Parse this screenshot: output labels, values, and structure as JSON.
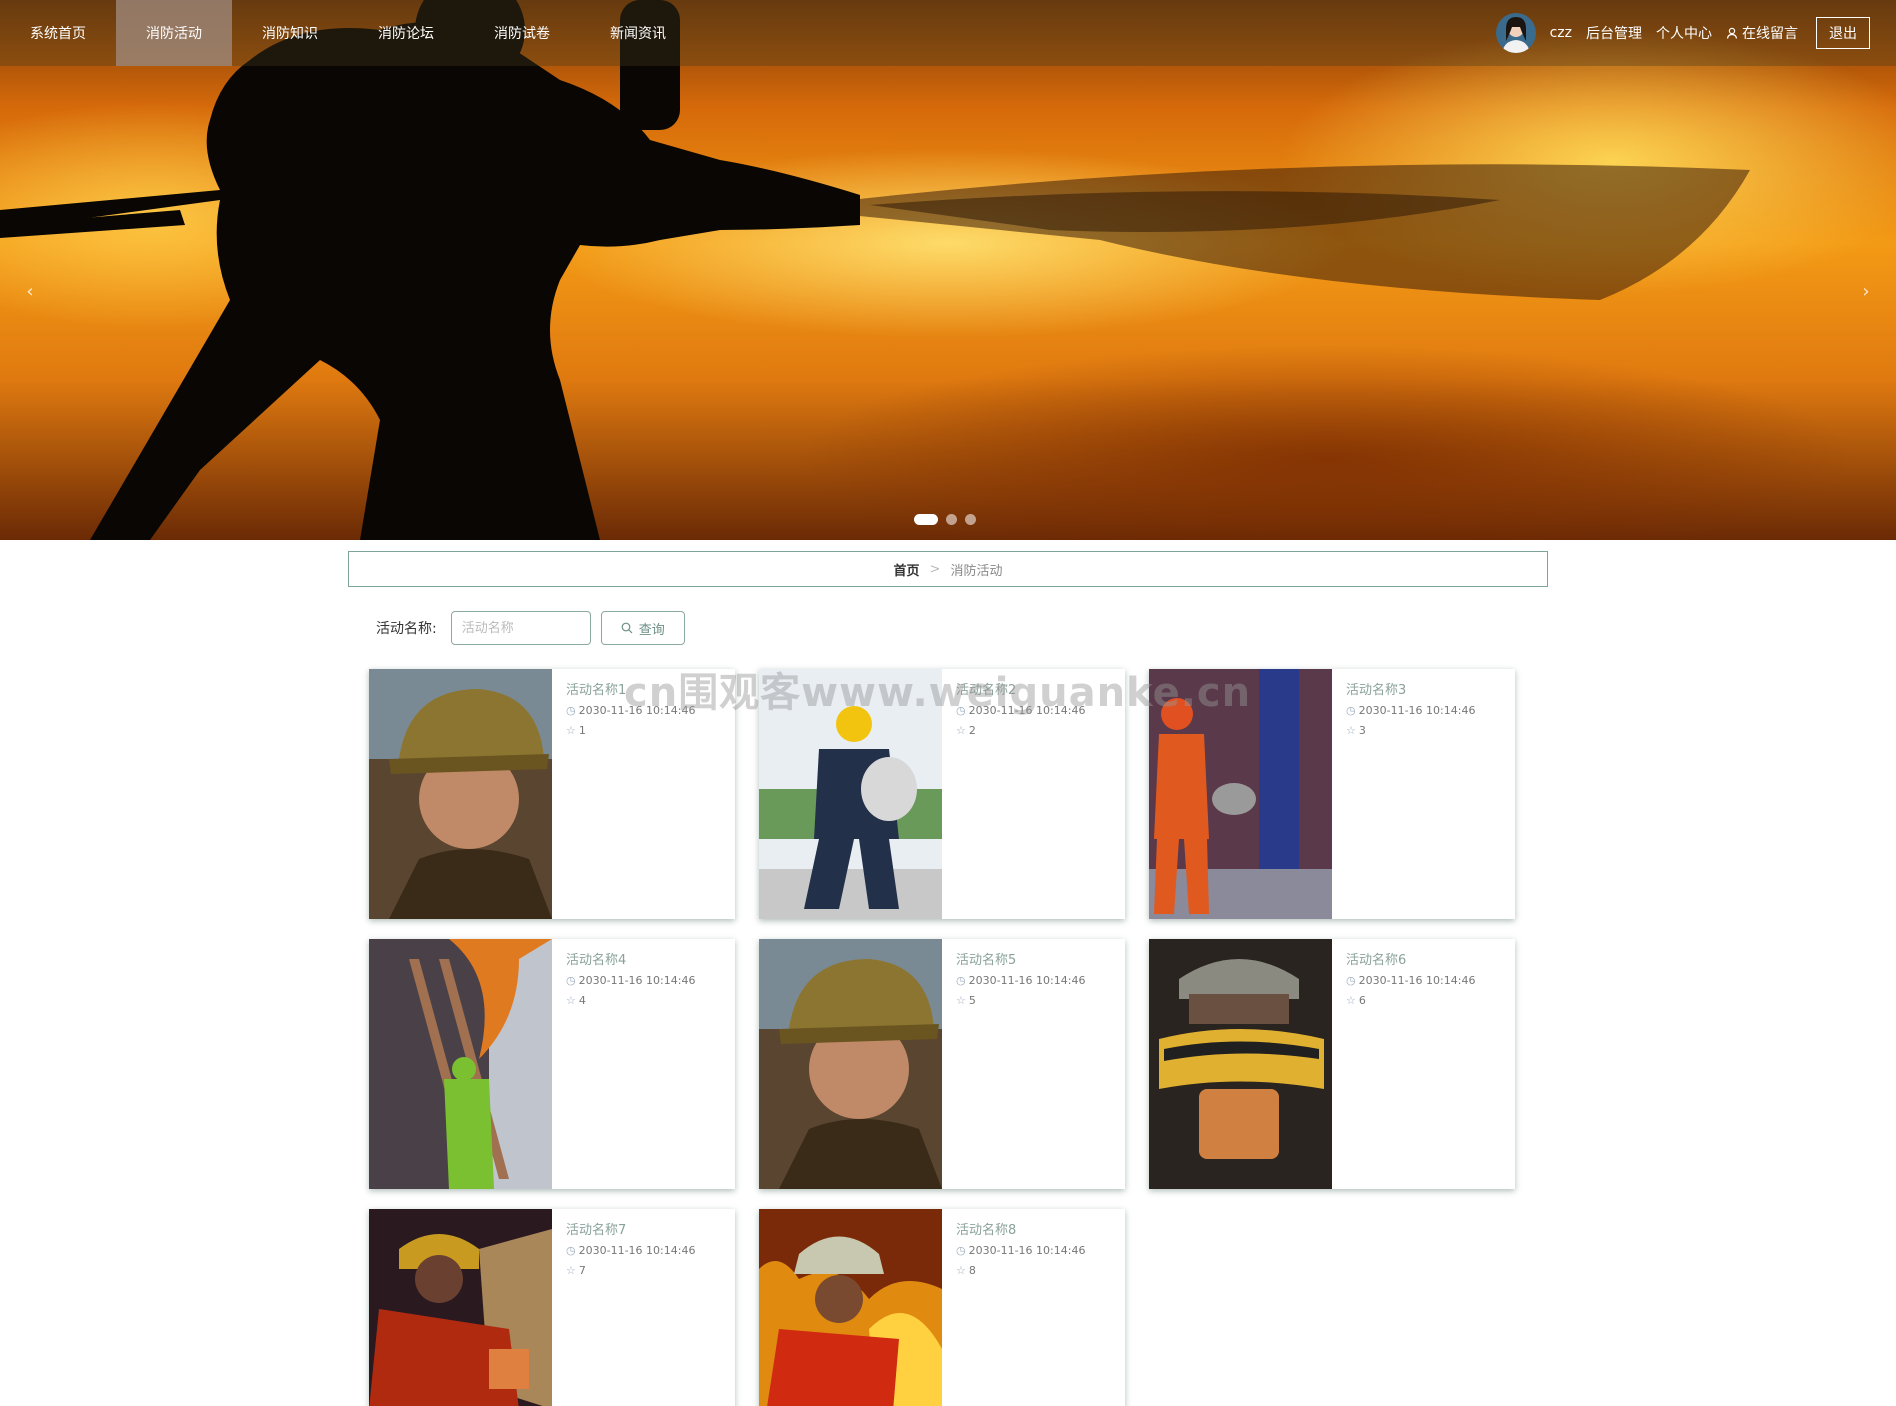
{
  "nav": {
    "items": [
      "系统首页",
      "消防活动",
      "消防知识",
      "消防论坛",
      "消防试卷",
      "新闻资讯"
    ],
    "active_index": 1
  },
  "user": {
    "name": "czz",
    "admin_label": "后台管理",
    "profile_label": "个人中心",
    "message_label": "在线留言",
    "logout_label": "退出"
  },
  "banner": {
    "prev_glyph": "‹",
    "next_glyph": "›",
    "slide_count": 3,
    "active_slide": 0
  },
  "breadcrumb": {
    "home": "首页",
    "separator": ">",
    "current": "消防活动"
  },
  "search": {
    "label": "活动名称:",
    "placeholder": "活动名称",
    "button_label": "查询"
  },
  "activities": [
    {
      "title": "活动名称1",
      "time": "2030-11-16 10:14:46",
      "likes": "1"
    },
    {
      "title": "活动名称2",
      "time": "2030-11-16 10:14:46",
      "likes": "2"
    },
    {
      "title": "活动名称3",
      "time": "2030-11-16 10:14:46",
      "likes": "3"
    },
    {
      "title": "活动名称4",
      "time": "2030-11-16 10:14:46",
      "likes": "4"
    },
    {
      "title": "活动名称5",
      "time": "2030-11-16 10:14:46",
      "likes": "5"
    },
    {
      "title": "活动名称6",
      "time": "2030-11-16 10:14:46",
      "likes": "6"
    },
    {
      "title": "活动名称7",
      "time": "2030-11-16 10:14:46",
      "likes": "7"
    },
    {
      "title": "活动名称8",
      "time": "2030-11-16 10:14:46",
      "likes": "8"
    }
  ],
  "watermark": "cn围观客www.weiguanke.cn",
  "colors": {
    "accent": "#7ea39a",
    "title_text": "#8aa29b",
    "nav_active_bg": "#a08c82"
  },
  "icons": {
    "clock": "clock-icon",
    "star": "star-icon",
    "search": "search-icon",
    "user": "user-icon"
  }
}
